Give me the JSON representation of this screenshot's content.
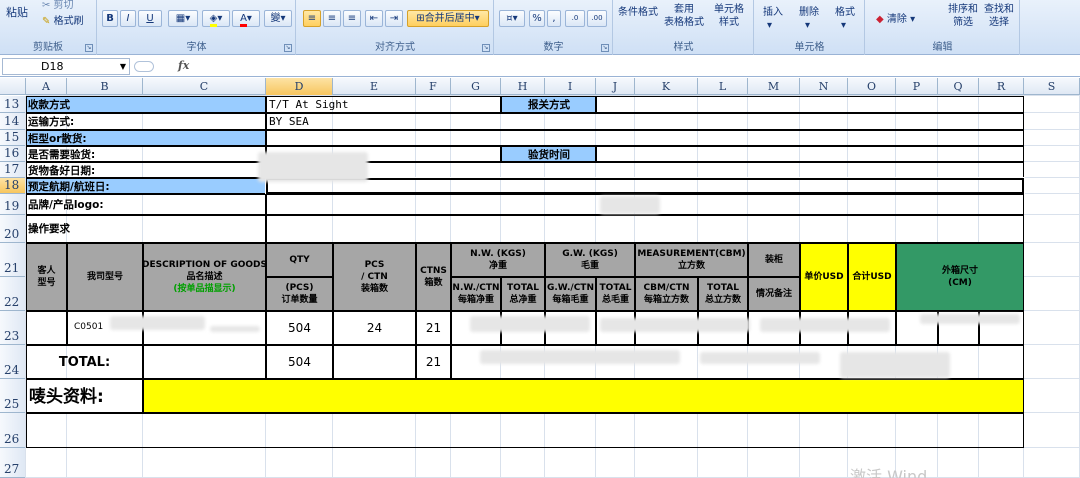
{
  "ribbon": {
    "clipboard": {
      "paste": "粘贴",
      "format_painter": "格式刷",
      "label": "剪贴板"
    },
    "font": {
      "label": "字体",
      "bold": "B",
      "italic": "I",
      "underline": "U",
      "wen": "變"
    },
    "alignment": {
      "label": "对齐方式",
      "merge_center": "合并后居中"
    },
    "number": {
      "label": "数字",
      "percent": "%",
      "comma": ","
    },
    "styles": {
      "label": "样式",
      "conditional": "条件格式",
      "table_format": "套用\n表格格式",
      "cell_style": "单元格\n样式"
    },
    "cells": {
      "label": "单元格",
      "insert": "插入",
      "delete": "删除",
      "format": "格式"
    },
    "editing": {
      "label": "编辑",
      "clear": "清除",
      "sort_filter": "排序和\n筛选",
      "find_select": "查找和\n选择"
    }
  },
  "formula_bar": {
    "name_box": "D18",
    "fx": "fx"
  },
  "columns": [
    "A",
    "B",
    "C",
    "D",
    "E",
    "F",
    "G",
    "H",
    "I",
    "J",
    "K",
    "L",
    "M",
    "N",
    "O",
    "P",
    "Q",
    "R",
    "S"
  ],
  "rows": [
    "13",
    "14",
    "15",
    "16",
    "17",
    "18",
    "19",
    "20",
    "21",
    "22",
    "23",
    "24",
    "25",
    "26",
    "27"
  ],
  "sheet": {
    "payment_label": "收款方式",
    "payment_value": "T/T At Sight",
    "customs_label": "报关方式",
    "transport_label": "运输方式:",
    "transport_value": "BY SEA",
    "container_label": "柜型or散货:",
    "inspection_label": "是否需要验货:",
    "inspection_time_label": "验货时间",
    "ready_date_label": "货物备好日期:",
    "voyage_label": "预定航期/航班日:",
    "brand_label": "品牌/产品logo:",
    "operation_label": "操作要求",
    "header": {
      "cust_model": "客人\n型号",
      "our_model": "我司型号",
      "desc_1": "DESCRIPTION OF GOODS",
      "desc_2": "品名描述",
      "desc_3": "(按单品描显示)",
      "qty": "QTY",
      "qty_sub": "(PCS)\n订单数量",
      "pcs_ctn": "PCS\n/ CTN\n装箱数",
      "ctns": "CTNS\n箱数",
      "nw": "N.W. (KGS)\n净重",
      "nw_ctn": "N.W./CTN\n每箱净重",
      "nw_total": "TOTAL\n总净重",
      "gw": "G.W. (KGS)\n毛重",
      "gw_ctn": "G.W./CTN\n每箱毛重",
      "gw_total": "TOTAL\n总毛重",
      "meas": "MEASUREMENT(CBM)\n立方数",
      "cbm_ctn": "CBM/CTN\n每箱立方数",
      "cbm_total": "TOTAL\n总立方数",
      "pack": "装柜",
      "pack_sub": "情况备注",
      "unit_price": "单价USD",
      "total_usd": "合计USD",
      "outer_size": "外箱尺寸\n(CM)"
    },
    "row23": {
      "model": "C0501",
      "qty": "504",
      "pcs_ctn": "24",
      "ctns": "21"
    },
    "total": {
      "label": "TOTAL:",
      "qty": "504",
      "ctns": "21"
    },
    "mark_label": "唛头资料:"
  },
  "watermark": "激活 Wind"
}
